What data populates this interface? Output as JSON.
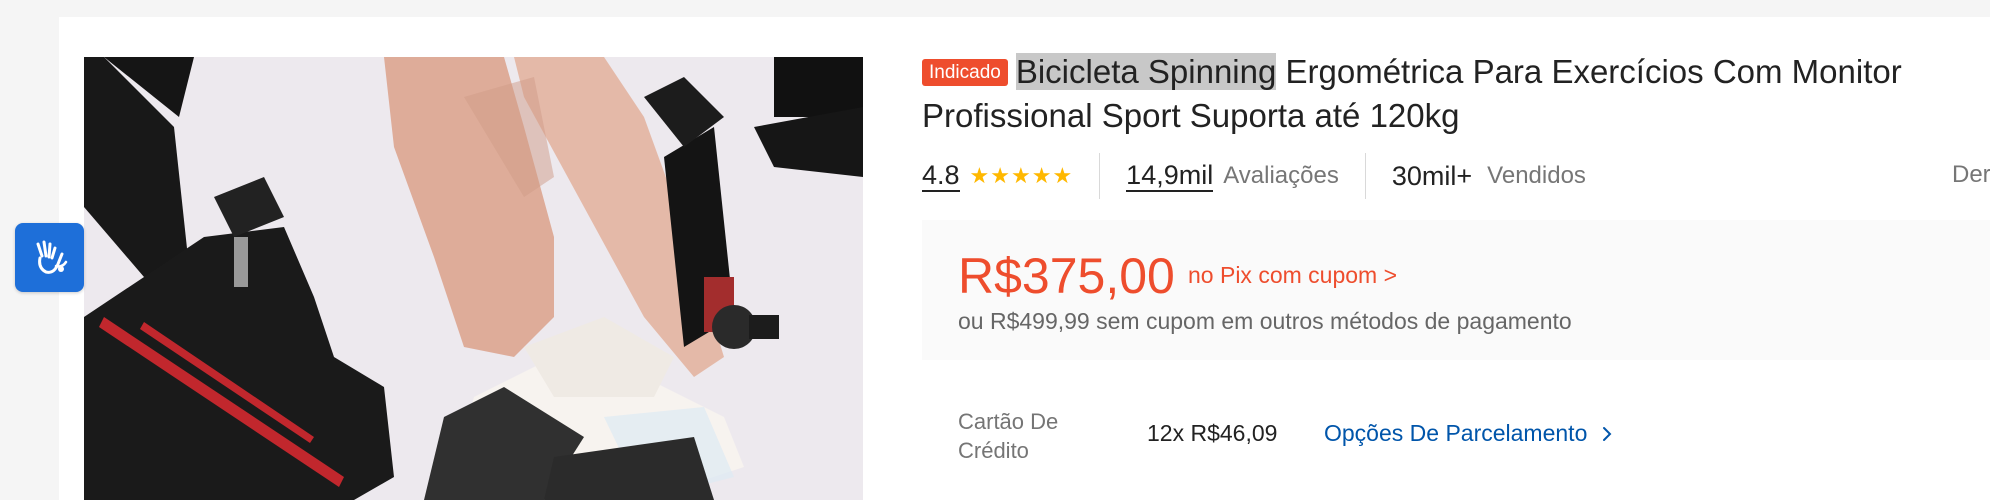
{
  "accessibility": {
    "icon": "sign-language-hands-icon",
    "color": "#1e6fd9"
  },
  "product": {
    "badge": "Indicado",
    "title_highlight": "Bicicleta Spinning",
    "title_rest": " Ergométrica Para Exercícios Com Monitor Profissional Sport Suporta até 120kg"
  },
  "rating": {
    "value": "4.8",
    "stars": "★★★★★",
    "stars_count": 5
  },
  "reviews": {
    "count": "14,9mil",
    "label": "Avaliações"
  },
  "sold": {
    "count": "30mil+",
    "label": "Vendidos"
  },
  "more_truncated": "Der",
  "price": {
    "main": "R$375,00",
    "pix_text": "no Pix com cupom >",
    "other_text": "ou R$499,99 sem cupom em outros métodos de pagamento"
  },
  "installment": {
    "label": "Cartão De Crédito",
    "value": "12x R$46,09",
    "link": "Opções De Parcelamento"
  },
  "colors": {
    "accent": "#ee4d2d",
    "link": "#0055aa",
    "star": "#ffb800"
  }
}
